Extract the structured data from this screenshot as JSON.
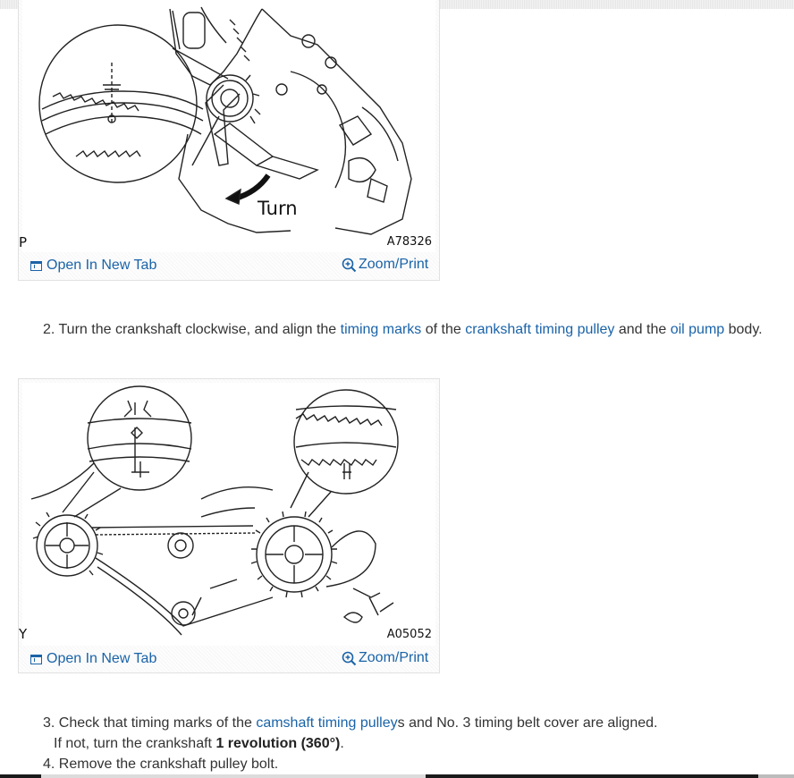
{
  "figures": [
    {
      "letter": "P",
      "code": "A78326",
      "annotation": "Turn",
      "open_tab_label": "Open In New Tab",
      "zoom_label": "Zoom/Print"
    },
    {
      "letter": "Y",
      "code": "A05052",
      "open_tab_label": "Open In New Tab",
      "zoom_label": "Zoom/Print"
    }
  ],
  "steps": {
    "step2": {
      "prefix": "2. Turn the crankshaft clockwise, and align the ",
      "link1": "timing marks",
      "mid1": " of the ",
      "link2": "crankshaft timing pulley",
      "mid2": " and the ",
      "link3": "oil pump",
      "suffix": " body."
    },
    "step3": {
      "prefix": "3. Check that timing marks of the ",
      "link1": "camshaft timing pulley",
      "suffix": "s and No. 3 timing belt cover are aligned."
    },
    "step3_note": {
      "prefix": "If not, turn the crankshaft ",
      "bold": "1 revolution (360°)",
      "suffix": "."
    },
    "step4": {
      "text": "4. Remove the crankshaft pulley bolt."
    }
  },
  "colors": {
    "link": "#1a63a8",
    "text": "#333333"
  },
  "icons": [
    "open-new-tab-icon",
    "zoom-icon"
  ]
}
